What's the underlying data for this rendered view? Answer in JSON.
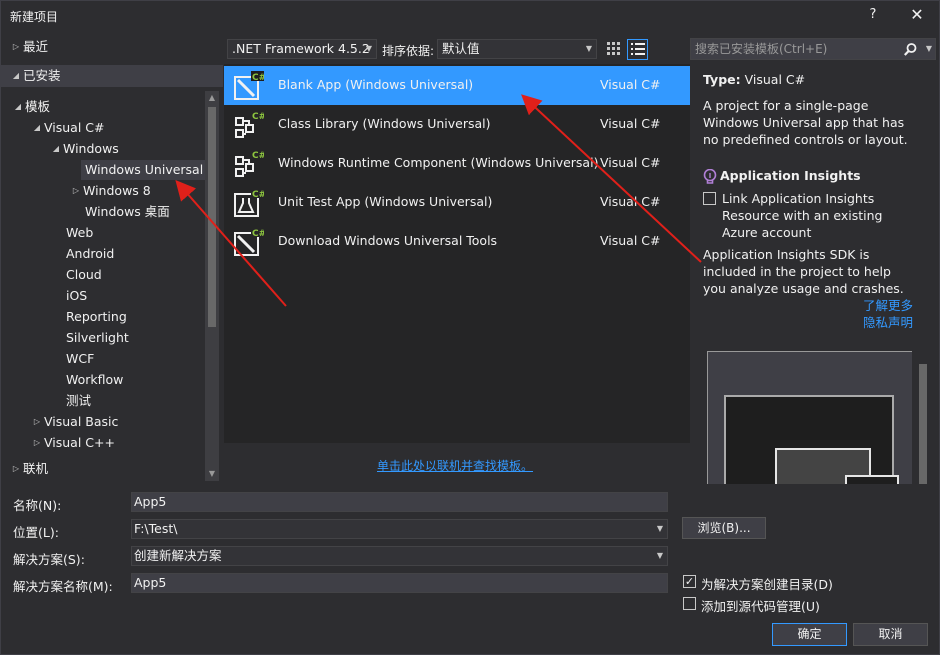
{
  "window": {
    "title": "新建项目",
    "help": "?",
    "close": "✕"
  },
  "tree": {
    "recent": "最近",
    "installed": "已安装",
    "templates": "模板",
    "visual_csharp": "Visual C#",
    "windows": "Windows",
    "windows_universal": "Windows Universal",
    "windows8": "Windows 8",
    "windows_desktop": "Windows 桌面",
    "web": "Web",
    "android": "Android",
    "cloud": "Cloud",
    "ios": "iOS",
    "reporting": "Reporting",
    "silverlight": "Silverlight",
    "wcf": "WCF",
    "workflow": "Workflow",
    "test": "测试",
    "visual_basic": "Visual Basic",
    "visual_cpp": "Visual C++",
    "online": "联机"
  },
  "filter": {
    "framework": ".NET Framework 4.5.2",
    "sort_label": "排序依据:",
    "sort_value": "默认值"
  },
  "templates": [
    {
      "name": "Blank App (Windows Universal)",
      "lang": "Visual C#"
    },
    {
      "name": "Class Library (Windows Universal)",
      "lang": "Visual C#"
    },
    {
      "name": "Windows Runtime Component (Windows Universal)",
      "lang": "Visual C#"
    },
    {
      "name": "Unit Test App (Windows Universal)",
      "lang": "Visual C#"
    },
    {
      "name": "Download Windows Universal Tools",
      "lang": "Visual C#"
    }
  ],
  "online_link": "单击此处以联机并查找模板。",
  "search": {
    "placeholder": "搜索已安装模板(Ctrl+E)"
  },
  "details": {
    "type_label": "Type:",
    "type_value": "Visual C#",
    "description": "A project for a single-page Windows Universal app that has no predefined controls or layout.",
    "ai_header": "Application Insights",
    "ai_checkbox": "Link Application Insights Resource with an existing Azure account",
    "ai_sdk": "Application Insights SDK is included in the project to help you analyze usage and crashes.",
    "learn_more": "了解更多",
    "privacy": "隐私声明"
  },
  "form": {
    "name_label": "名称(N):",
    "name_value": "App5",
    "location_label": "位置(L):",
    "location_value": "F:\\Test\\",
    "solution_label": "解决方案(S):",
    "solution_value": "创建新解决方案",
    "solution_name_label": "解决方案名称(M):",
    "solution_name_value": "App5",
    "browse": "浏览(B)...",
    "create_dir": "为解决方案创建目录(D)",
    "add_source_control": "添加到源代码管理(U)",
    "ok": "确定",
    "cancel": "取消"
  },
  "colors": {
    "accent": "#3399ff",
    "background": "#2d2d30",
    "annotation": "#e0201a"
  }
}
